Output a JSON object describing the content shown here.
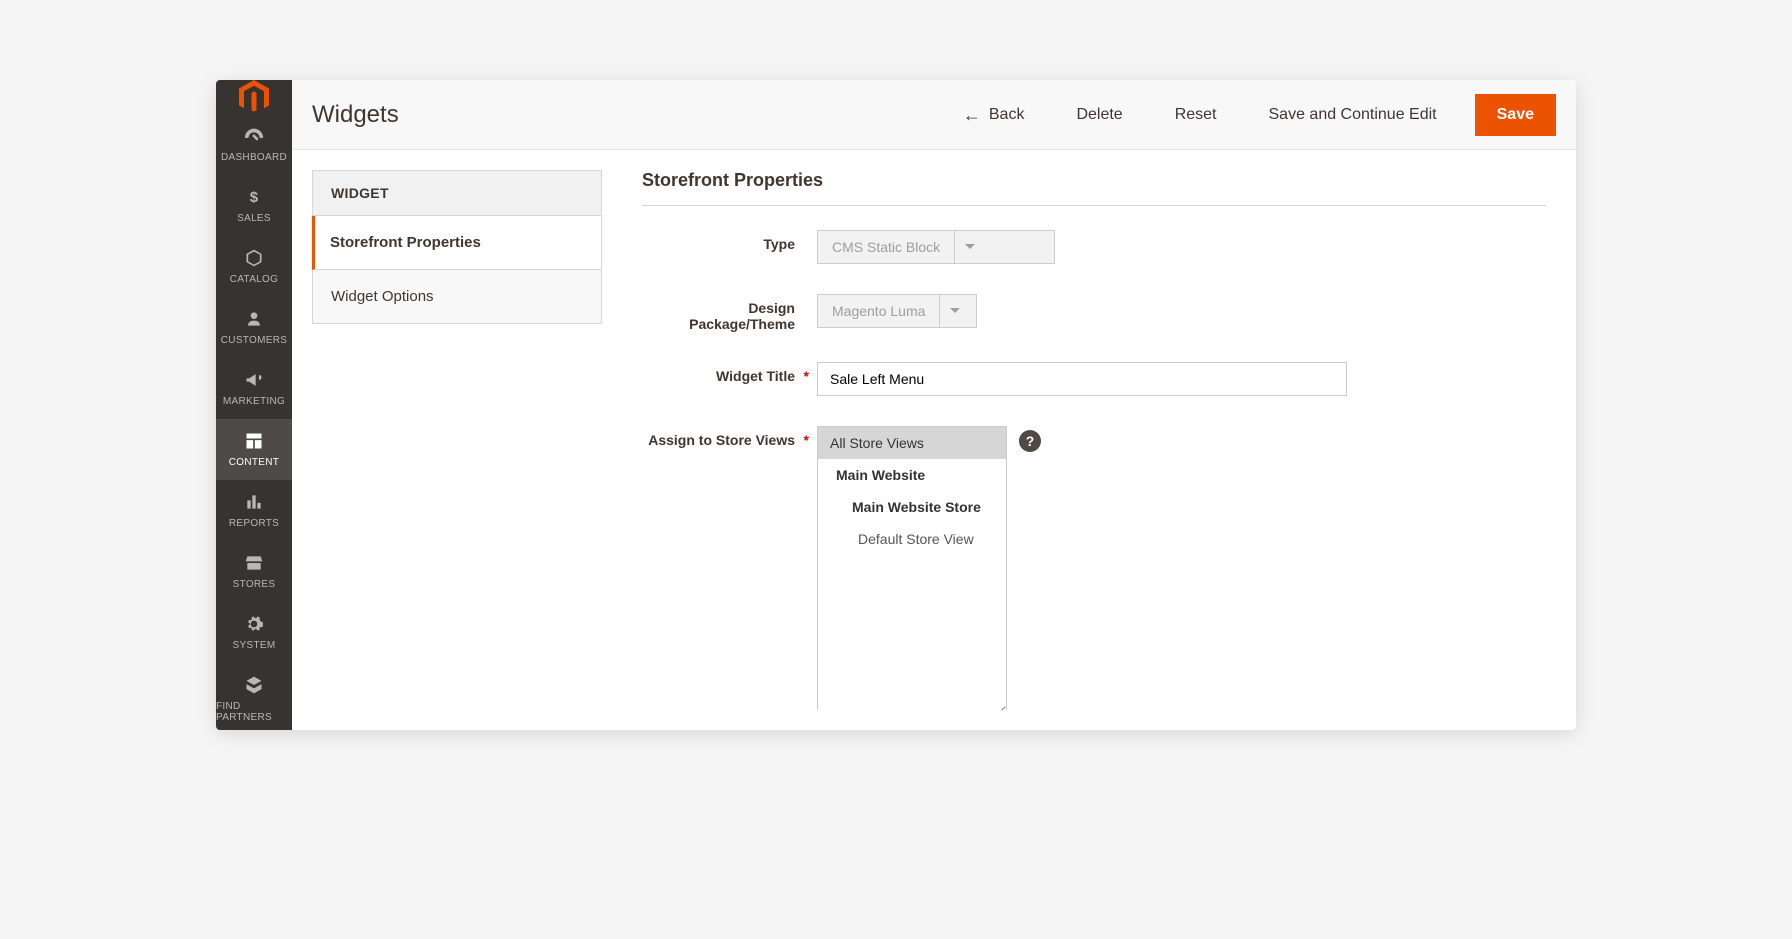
{
  "page": {
    "title": "Widgets"
  },
  "toolbar": {
    "back": "Back",
    "delete": "Delete",
    "reset": "Reset",
    "save_continue": "Save and Continue Edit",
    "save": "Save"
  },
  "sidebar": {
    "items": [
      {
        "id": "dashboard",
        "label": "DASHBOARD"
      },
      {
        "id": "sales",
        "label": "SALES"
      },
      {
        "id": "catalog",
        "label": "CATALOG"
      },
      {
        "id": "customers",
        "label": "CUSTOMERS"
      },
      {
        "id": "marketing",
        "label": "MARKETING"
      },
      {
        "id": "content",
        "label": "CONTENT"
      },
      {
        "id": "reports",
        "label": "REPORTS"
      },
      {
        "id": "stores",
        "label": "STORES"
      },
      {
        "id": "system",
        "label": "SYSTEM"
      },
      {
        "id": "find_partners",
        "label": "FIND PARTNERS"
      }
    ],
    "active": "content"
  },
  "tabs": {
    "heading": "WIDGET",
    "items": [
      {
        "id": "storefront",
        "label": "Storefront Properties"
      },
      {
        "id": "options",
        "label": "Widget Options"
      }
    ],
    "active": "storefront"
  },
  "form": {
    "section_title": "Storefront Properties",
    "type": {
      "label": "Type",
      "value": "CMS Static Block"
    },
    "theme": {
      "label": "Design Package/Theme",
      "value": "Magento Luma"
    },
    "widget_title": {
      "label": "Widget Title",
      "value": "Sale Left Menu"
    },
    "store_views": {
      "label": "Assign to Store Views",
      "options": [
        {
          "label": "All Store Views",
          "level": 0,
          "selected": true
        },
        {
          "label": "Main Website",
          "level": 1,
          "selected": false
        },
        {
          "label": "Main Website Store",
          "level": 2,
          "selected": false
        },
        {
          "label": "Default Store View",
          "level": 3,
          "selected": false
        }
      ]
    }
  }
}
